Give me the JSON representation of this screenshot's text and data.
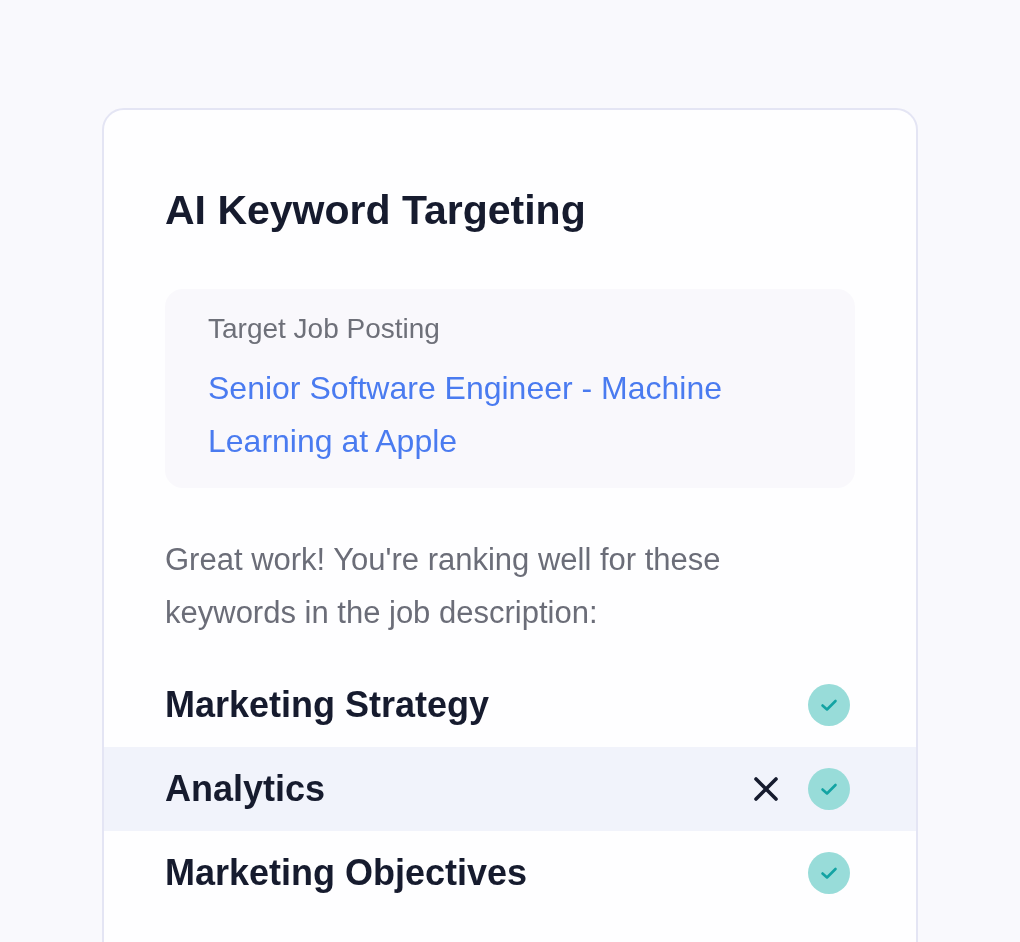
{
  "card": {
    "title": "AI Keyword Targeting"
  },
  "job_posting": {
    "label": "Target Job Posting",
    "title": "Senior Software Engineer - Machine Learning at Apple"
  },
  "message": "Great work! You're ranking well for these keywords in the job description:",
  "keywords": [
    {
      "label": "Marketing Strategy",
      "hovered": false,
      "matched": true
    },
    {
      "label": "Analytics",
      "hovered": true,
      "matched": true
    },
    {
      "label": "Marketing Objectives",
      "hovered": false,
      "matched": true
    }
  ]
}
